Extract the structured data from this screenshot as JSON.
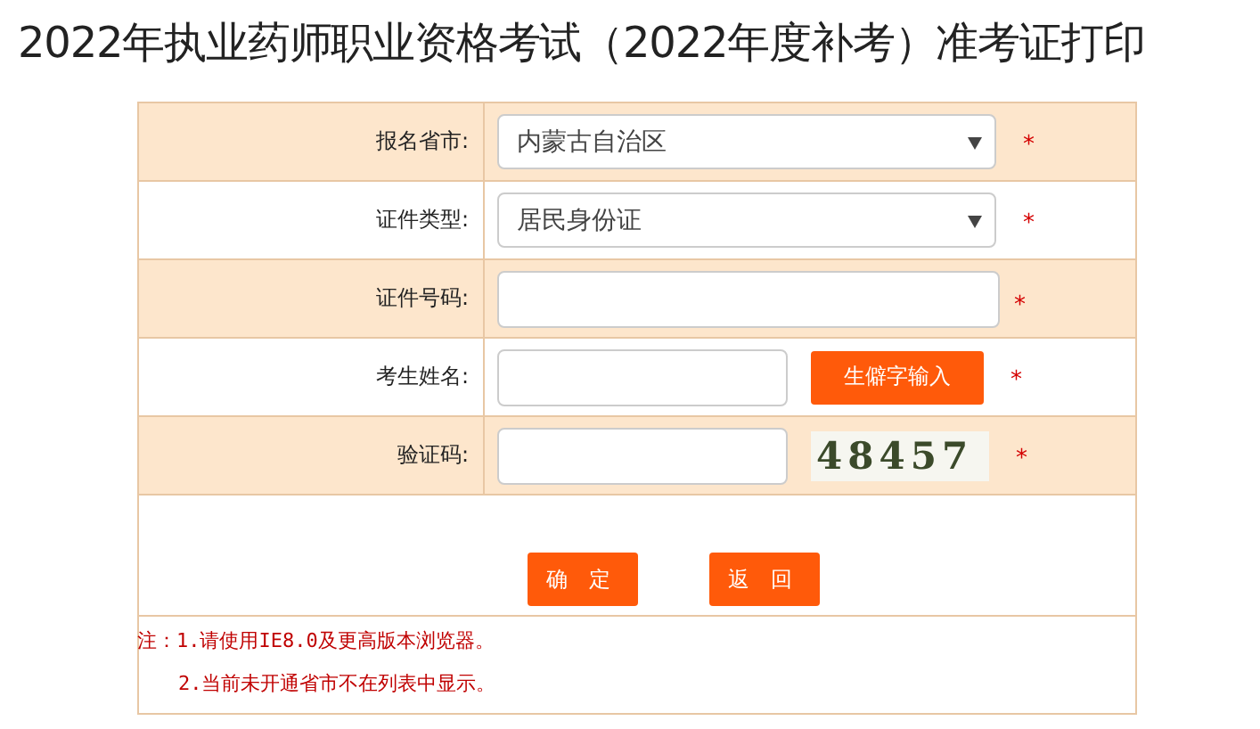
{
  "title": "2022年执业药师职业资格考试（2022年度补考）准考证打印",
  "rows": [
    {
      "kind": "select",
      "label": "报名省市:",
      "value": "内蒙古自治区",
      "required": "*"
    },
    {
      "kind": "select",
      "label": "证件类型:",
      "value": "居民身份证",
      "required": "*"
    },
    {
      "kind": "input",
      "label": "证件号码:",
      "required": "*"
    },
    {
      "kind": "input_button",
      "label": "考生姓名:",
      "button": "生僻字输入",
      "required": "*"
    },
    {
      "kind": "captcha",
      "label": "验证码:",
      "captcha": "48457",
      "required": "*"
    }
  ],
  "buttons": [
    "确 定",
    "返 回"
  ],
  "notes": [
    "注：1.请使用IE8.0及更高版本浏览器。",
    "2.当前未开通省市不在列表中显示。"
  ]
}
